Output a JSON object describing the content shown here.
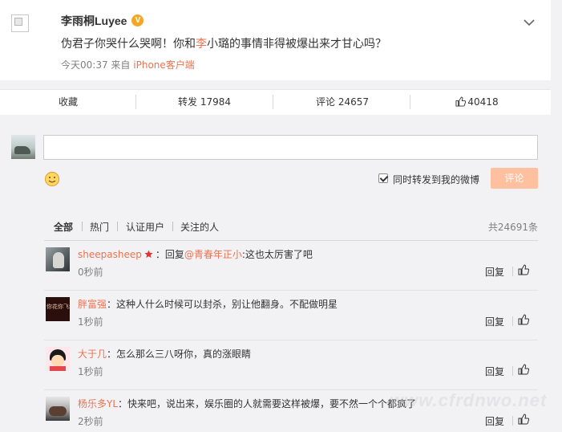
{
  "post": {
    "author": "李雨桐Luyee",
    "text_before": "伪君子你哭什么哭啊！你和",
    "text_highlight": "李",
    "text_after": "小璐的事情非得被爆出来才甘心吗？",
    "time": "今天00:37",
    "from_label": "来自",
    "source": "iPhone客户端"
  },
  "actions": {
    "favorite": "收藏",
    "repost": "转发 17984",
    "comment": "评论 24657",
    "like": "40418"
  },
  "composer": {
    "repost_label": "同时转发到我的微博",
    "submit": "评论"
  },
  "filters": {
    "items": [
      "全部",
      "热门",
      "认证用户",
      "关注的人"
    ],
    "total": "共24691条"
  },
  "comments": [
    {
      "user": "sheepasheep",
      "text_before": "：回复",
      "mention": "@青春年正小",
      "text_after": ":这也太厉害了吧",
      "time": "0秒前",
      "reply": "回复"
    },
    {
      "user": "胖富强",
      "text": "：这种人什么时候可以封杀，别让他翻身。不配做明星",
      "time": "1秒前",
      "reply": "回复",
      "avatar_text": "你花你飞坊"
    },
    {
      "user": "大于几",
      "text": "：怎么那么三八呀你，真的涨眼睛",
      "time": "1秒前",
      "reply": "回复"
    },
    {
      "user": "杨乐多YL",
      "text": "：快来吧，说出来，娱乐圈的人就需要这样被爆，要不然一个个都疯了",
      "time": "2秒前",
      "reply": "回复"
    }
  ],
  "watermark": "www.cfrdnwo.net",
  "colors": {
    "accent": "#eb7350",
    "submit_disabled": "#ffc09f",
    "vip_badge": "#f5a623",
    "background": "#f2f2f5"
  },
  "icons": [
    "chevron-down-icon",
    "thumbs-up-icon",
    "smiley-icon",
    "star-badge-icon",
    "vip-badge-icon"
  ]
}
